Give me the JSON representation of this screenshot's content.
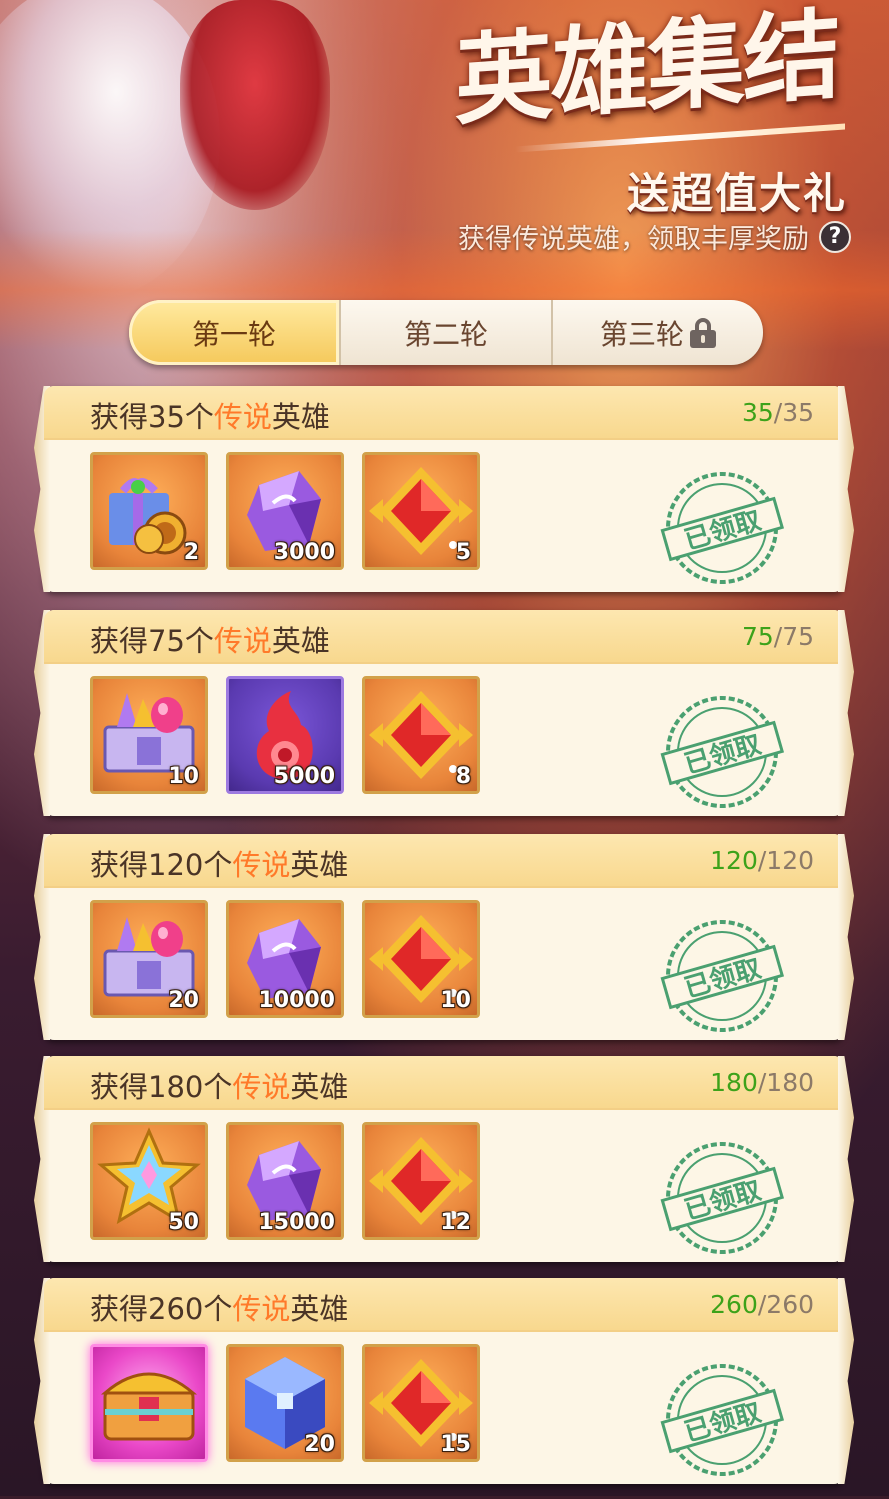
{
  "banner": {
    "title": "英雄集结",
    "subtitle": "送超值大礼",
    "description": "获得传说英雄，领取丰厚奖励",
    "help_icon": "?"
  },
  "tabs": [
    {
      "label": "第一轮",
      "active": true,
      "locked": false
    },
    {
      "label": "第二轮",
      "active": false,
      "locked": false
    },
    {
      "label": "第三轮",
      "active": false,
      "locked": true
    }
  ],
  "colors": {
    "highlight": "#ff7a2a",
    "progress_current": "#3da21a",
    "progress_total": "#8c7a68",
    "stamp": "#4aa070"
  },
  "cards": [
    {
      "title_prefix": "获得35个",
      "title_highlight": "传说",
      "title_suffix": "英雄",
      "progress_current": "35",
      "progress_total": "/35",
      "items": [
        {
          "icon": "gift-box-with-coins-icon",
          "qty": "2"
        },
        {
          "icon": "purple-crystal-icon",
          "qty": "3000"
        },
        {
          "icon": "red-gem-emblem-icon",
          "qty": "5"
        }
      ],
      "stamp": "已领取"
    },
    {
      "title_prefix": "获得75个",
      "title_highlight": "传说",
      "title_suffix": "英雄",
      "progress_current": "75",
      "progress_total": "/75",
      "items": [
        {
          "icon": "gem-chest-icon",
          "qty": "10"
        },
        {
          "icon": "red-flame-orb-icon",
          "qty": "5000"
        },
        {
          "icon": "red-gem-emblem-icon",
          "qty": "8"
        }
      ],
      "stamp": "已领取"
    },
    {
      "title_prefix": "获得120个",
      "title_highlight": "传说",
      "title_suffix": "英雄",
      "progress_current": "120",
      "progress_total": "/120",
      "items": [
        {
          "icon": "gem-chest-icon",
          "qty": "20"
        },
        {
          "icon": "purple-crystal-icon",
          "qty": "10000"
        },
        {
          "icon": "red-gem-emblem-icon",
          "qty": "10"
        }
      ],
      "stamp": "已领取"
    },
    {
      "title_prefix": "获得180个",
      "title_highlight": "传说",
      "title_suffix": "英雄",
      "progress_current": "180",
      "progress_total": "/180",
      "items": [
        {
          "icon": "rainbow-star-badge-icon",
          "qty": "50"
        },
        {
          "icon": "purple-crystal-icon",
          "qty": "15000"
        },
        {
          "icon": "red-gem-emblem-icon",
          "qty": "12"
        }
      ],
      "stamp": "已领取"
    },
    {
      "title_prefix": "获得260个",
      "title_highlight": "传说",
      "title_suffix": "英雄",
      "progress_current": "260",
      "progress_total": "/260",
      "items": [
        {
          "icon": "legendary-treasure-chest-icon",
          "qty": ""
        },
        {
          "icon": "blue-crystal-cube-icon",
          "qty": "20"
        },
        {
          "icon": "red-gem-emblem-icon",
          "qty": "15"
        }
      ],
      "stamp": "已领取"
    }
  ]
}
